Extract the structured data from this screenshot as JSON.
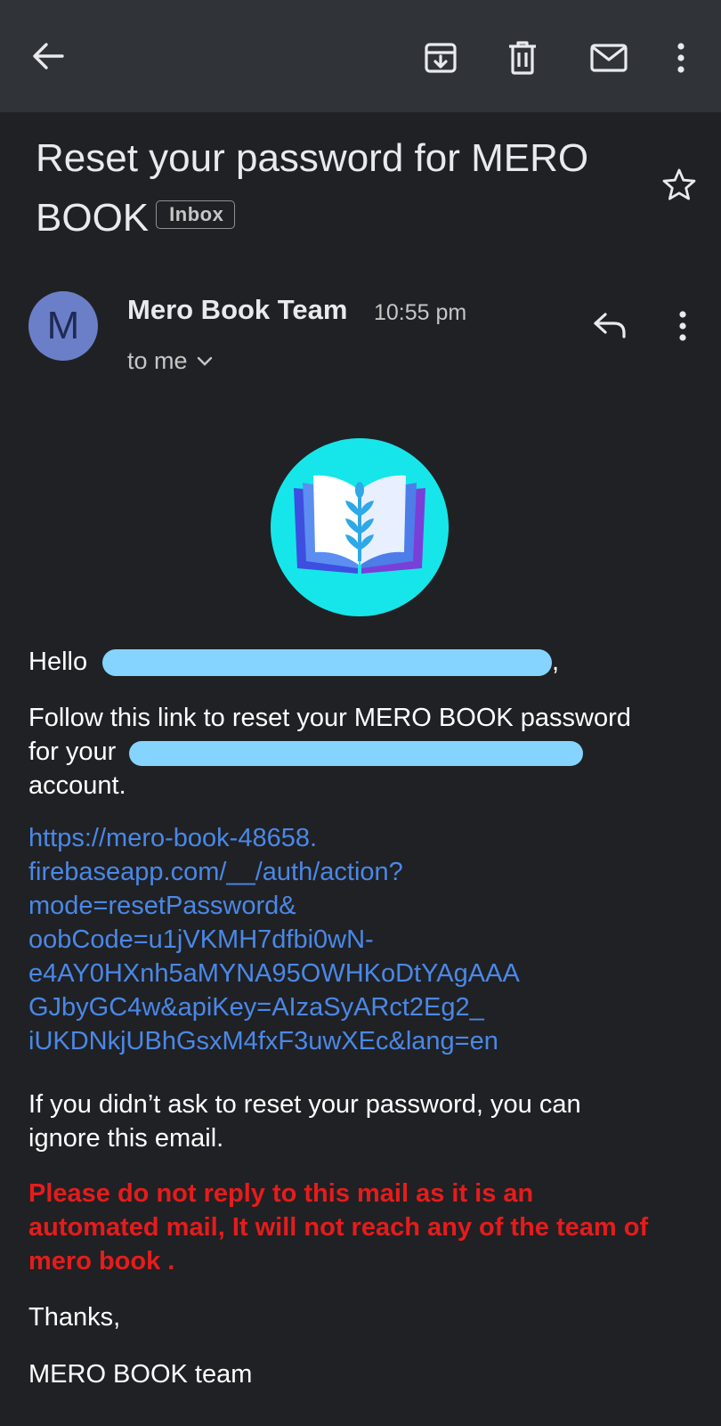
{
  "toolbar": {
    "back_icon": "arrow-left-icon",
    "archive_icon": "archive-icon",
    "delete_icon": "trash-icon",
    "mark_unread_icon": "mail-icon",
    "more_icon": "more-vert-icon"
  },
  "email": {
    "subject": "Reset your password for MERO BOOK",
    "label": "Inbox",
    "sender_initial": "M",
    "sender_name": "Mero Book Team",
    "time": "10:55 pm",
    "recipient": "to me",
    "body": {
      "greeting": "Hello",
      "greeting_suffix": ",",
      "instruction_line1": "Follow this link to reset your MERO BOOK password",
      "instruction_for": "for your",
      "instruction_account": "account.",
      "reset_link_lines": [
        "https://mero-book-48658.",
        "firebaseapp.com/__/auth/action?",
        "mode=resetPassword&",
        "oobCode=u1jVKMH7dfbi0wN-",
        "e4AY0HXnh5aMYNA95OWHKoDtYAgAAA",
        "GJbyGC4w&apiKey=AIzaSyARct2Eg2_",
        "iUKDNkjUBhGsxM4fxF3uwXEc&lang=en"
      ],
      "ignore_line1": "If you didn’t ask to reset your password, you can",
      "ignore_line2": "ignore this email.",
      "warning_lines": [
        "Please do not reply to this mail as it is an",
        "automated mail, It will not reach any of the team of",
        "mero book ."
      ],
      "thanks": "Thanks,",
      "signature": "MERO BOOK team"
    }
  },
  "colors": {
    "background": "#202124",
    "appbar": "#303338",
    "link": "#4a88e8",
    "warning": "#e51c1c",
    "avatar": "#6b7fc9",
    "logo_bg": "#16e6ea",
    "redaction": "#85d4ff"
  }
}
